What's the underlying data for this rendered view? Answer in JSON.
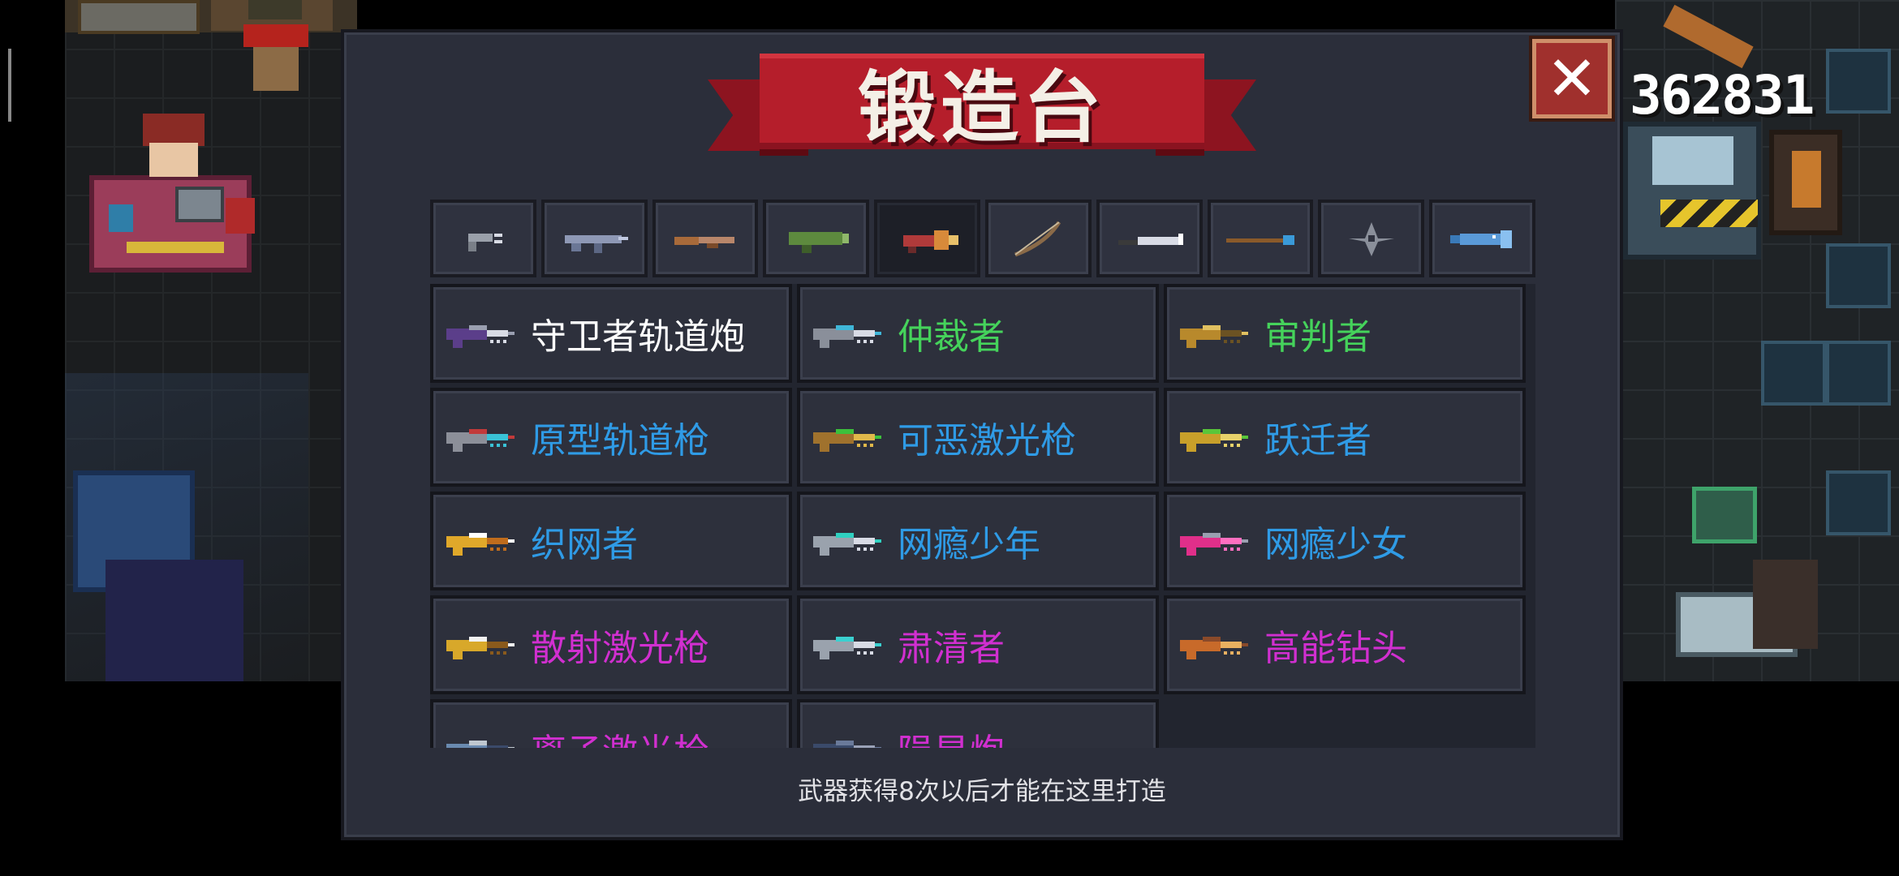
{
  "title": "锻造台",
  "close_button": {
    "label": "✕",
    "icon": "close-icon"
  },
  "currency": {
    "value": "362831"
  },
  "tabs": [
    {
      "icon": "pistol-icon",
      "active": false
    },
    {
      "icon": "rifle-icon",
      "active": false
    },
    {
      "icon": "shotgun-icon",
      "active": false
    },
    {
      "icon": "launcher-icon",
      "active": false
    },
    {
      "icon": "laser-gun-icon",
      "active": true
    },
    {
      "icon": "bow-icon",
      "active": false
    },
    {
      "icon": "sword-icon",
      "active": false
    },
    {
      "icon": "spear-icon",
      "active": false
    },
    {
      "icon": "shuriken-icon",
      "active": false
    },
    {
      "icon": "fish-icon",
      "active": false
    }
  ],
  "colors": {
    "white": "#ffffff",
    "green": "#45d35b",
    "blue": "#2f9be6",
    "purple": "#d12fd0",
    "panel": "#2b2e3a",
    "ribbon": "#b51e2b"
  },
  "weapons": [
    {
      "name": "守卫者轨道炮",
      "rarity": "white",
      "icon": "railgun-icon",
      "palette": [
        "#5b3e8a",
        "#9a9fb0",
        "#d8dbe5"
      ]
    },
    {
      "name": "仲裁者",
      "rarity": "green",
      "icon": "laser-rifle-icon",
      "palette": [
        "#8a8f9a",
        "#3fb6d8",
        "#d8dbe5"
      ]
    },
    {
      "name": "审判者",
      "rarity": "green",
      "icon": "gold-rifle-icon",
      "palette": [
        "#b8892c",
        "#e0c060",
        "#6b5223"
      ]
    },
    {
      "name": "原型轨道枪",
      "rarity": "blue",
      "icon": "prototype-rail-icon",
      "palette": [
        "#8c8f99",
        "#c23a3a",
        "#39c2d6"
      ]
    },
    {
      "name": "可恶激光枪",
      "rarity": "blue",
      "icon": "green-laser-icon",
      "palette": [
        "#a0722d",
        "#3cc13c",
        "#e0b84a"
      ]
    },
    {
      "name": "跃迁者",
      "rarity": "blue",
      "icon": "warp-gun-icon",
      "palette": [
        "#c8a02a",
        "#59c63a",
        "#e8d26a"
      ]
    },
    {
      "name": "织网者",
      "rarity": "blue",
      "icon": "web-gun-icon",
      "palette": [
        "#e0a82a",
        "#ffffff",
        "#c06c1c"
      ]
    },
    {
      "name": "网瘾少年",
      "rarity": "blue",
      "icon": "net-boy-icon",
      "palette": [
        "#9aa2ad",
        "#2fd0c0",
        "#d8dbe5"
      ]
    },
    {
      "name": "网瘾少女",
      "rarity": "blue",
      "icon": "net-girl-icon",
      "palette": [
        "#e02f8a",
        "#9a9fb0",
        "#ff6fc0"
      ]
    },
    {
      "name": "散射激光枪",
      "rarity": "purple",
      "icon": "scatter-laser-icon",
      "palette": [
        "#d8a82a",
        "#f2f2f2",
        "#8a5a1c"
      ]
    },
    {
      "name": "肃清者",
      "rarity": "purple",
      "icon": "purger-icon",
      "palette": [
        "#9aa2ad",
        "#3ad0d0",
        "#d8dbe5"
      ]
    },
    {
      "name": "高能钻头",
      "rarity": "purple",
      "icon": "drill-icon",
      "palette": [
        "#c86a2a",
        "#8a4a2a",
        "#e8b060"
      ]
    },
    {
      "name": "离子激光枪",
      "rarity": "purple",
      "icon": "ion-laser-icon",
      "palette": [
        "#6a8ab0",
        "#c0c8d0",
        "#3a4a6a"
      ]
    },
    {
      "name": "陨星炮",
      "rarity": "purple",
      "icon": "meteor-cannon-icon",
      "palette": [
        "#3a4a6a",
        "#6a7a9a",
        "#9aa2b8"
      ]
    }
  ],
  "hint": "武器获得8次以后才能在这里打造"
}
